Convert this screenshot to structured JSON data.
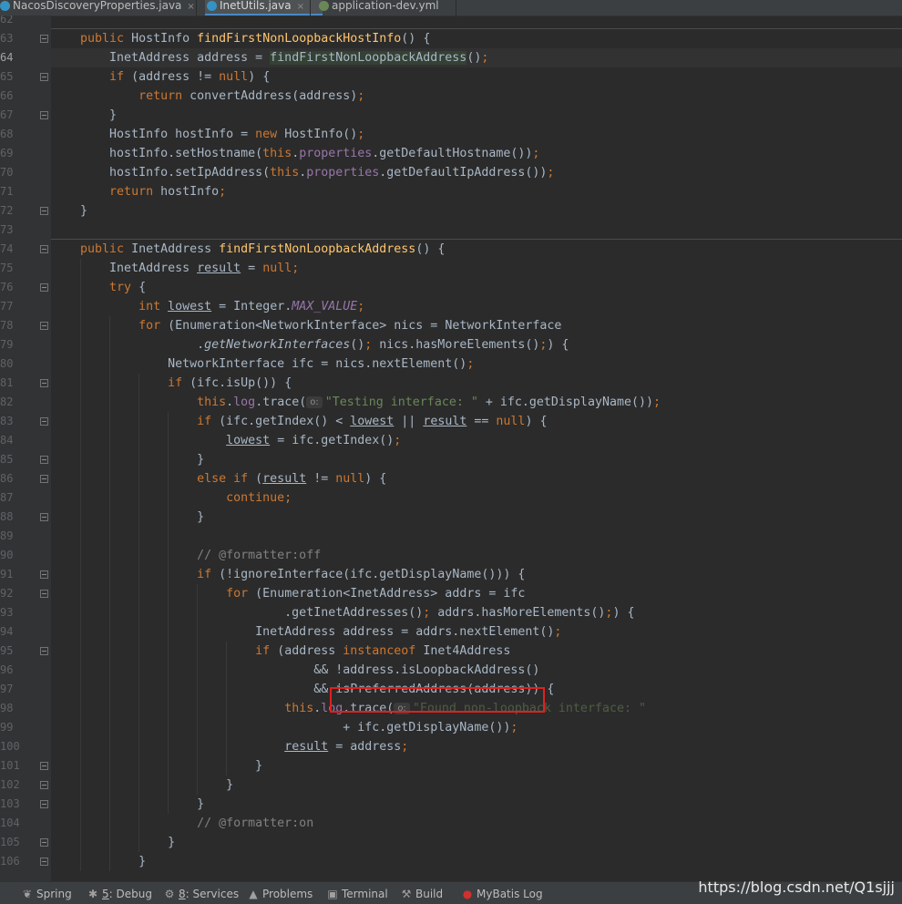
{
  "tabs": [
    {
      "label": "NacosDiscoveryProperties.java",
      "active": false,
      "icon_color": "#3592c4"
    },
    {
      "label": "InetUtils.java",
      "active": true,
      "icon_color": "#3592c4"
    },
    {
      "label": "application-dev.yml",
      "active": false,
      "icon_color": "#6a8759"
    }
  ],
  "tab_close_glyph": "×",
  "current_line": "64",
  "lines": [
    {
      "n": "62",
      "segs": []
    },
    {
      "n": "63",
      "segs": [
        [
          "    ",
          ""
        ],
        [
          "public ",
          "kw"
        ],
        [
          "HostInfo ",
          ""
        ],
        [
          "findFirstNonLoopbackHostInfo",
          "fn"
        ],
        [
          "() {",
          ""
        ]
      ]
    },
    {
      "n": "64",
      "segs": [
        [
          "        InetAddress address = ",
          ""
        ],
        [
          "findFirstNonLoopbackAddress",
          "hl"
        ],
        [
          "()",
          ""
        ],
        [
          ";",
          "kw"
        ]
      ]
    },
    {
      "n": "65",
      "segs": [
        [
          "        ",
          ""
        ],
        [
          "if ",
          "kw"
        ],
        [
          "(address != ",
          ""
        ],
        [
          "null",
          "kw"
        ],
        [
          ") {",
          ""
        ]
      ]
    },
    {
      "n": "66",
      "segs": [
        [
          "            ",
          ""
        ],
        [
          "return ",
          "kw"
        ],
        [
          "convertAddress(address)",
          ""
        ],
        [
          ";",
          "kw"
        ]
      ]
    },
    {
      "n": "67",
      "segs": [
        [
          "        }",
          ""
        ]
      ]
    },
    {
      "n": "68",
      "segs": [
        [
          "        HostInfo hostInfo = ",
          ""
        ],
        [
          "new ",
          "kw"
        ],
        [
          "HostInfo()",
          ""
        ],
        [
          ";",
          "kw"
        ]
      ]
    },
    {
      "n": "69",
      "segs": [
        [
          "        hostInfo.setHostname(",
          ""
        ],
        [
          "this",
          "kw"
        ],
        [
          ".",
          ""
        ],
        [
          "properties",
          "fld"
        ],
        [
          ".getDefaultHostname())",
          ""
        ],
        [
          ";",
          "kw"
        ]
      ]
    },
    {
      "n": "70",
      "segs": [
        [
          "        hostInfo.setIpAddress(",
          ""
        ],
        [
          "this",
          "kw"
        ],
        [
          ".",
          ""
        ],
        [
          "properties",
          "fld"
        ],
        [
          ".getDefaultIpAddress())",
          ""
        ],
        [
          ";",
          "kw"
        ]
      ]
    },
    {
      "n": "71",
      "segs": [
        [
          "        ",
          ""
        ],
        [
          "return ",
          "kw"
        ],
        [
          "hostInfo",
          ""
        ],
        [
          ";",
          "kw"
        ]
      ]
    },
    {
      "n": "72",
      "segs": [
        [
          "    }",
          ""
        ]
      ]
    },
    {
      "n": "73",
      "segs": []
    },
    {
      "n": "74",
      "segs": [
        [
          "    ",
          ""
        ],
        [
          "public ",
          "kw"
        ],
        [
          "InetAddress ",
          ""
        ],
        [
          "findFirstNonLoopbackAddress",
          "fn"
        ],
        [
          "() {",
          ""
        ]
      ]
    },
    {
      "n": "75",
      "segs": [
        [
          "        InetAddress ",
          ""
        ],
        [
          "result",
          "ul"
        ],
        [
          " = ",
          ""
        ],
        [
          "null",
          "kw"
        ],
        [
          ";",
          "kw"
        ]
      ]
    },
    {
      "n": "76",
      "segs": [
        [
          "        ",
          ""
        ],
        [
          "try ",
          "kw"
        ],
        [
          "{",
          ""
        ]
      ]
    },
    {
      "n": "77",
      "segs": [
        [
          "            ",
          ""
        ],
        [
          "int ",
          "kw"
        ],
        [
          "lowest",
          "ul"
        ],
        [
          " = Integer.",
          ""
        ],
        [
          "MAX_VALUE",
          "cst"
        ],
        [
          ";",
          "kw"
        ]
      ]
    },
    {
      "n": "78",
      "segs": [
        [
          "            ",
          ""
        ],
        [
          "for ",
          "kw"
        ],
        [
          "(Enumeration<NetworkInterface> nics = NetworkInterface",
          ""
        ]
      ]
    },
    {
      "n": "79",
      "segs": [
        [
          "                    .",
          ""
        ],
        [
          "getNetworkInterfaces",
          "ital"
        ],
        [
          "()",
          ""
        ],
        [
          "; ",
          "kw"
        ],
        [
          "nics.hasMoreElements()",
          ""
        ],
        [
          ";",
          "kw"
        ],
        [
          ") {",
          ""
        ]
      ]
    },
    {
      "n": "80",
      "segs": [
        [
          "                NetworkInterface ifc = nics.nextElement()",
          ""
        ],
        [
          ";",
          "kw"
        ]
      ]
    },
    {
      "n": "81",
      "segs": [
        [
          "                ",
          ""
        ],
        [
          "if ",
          "kw"
        ],
        [
          "(ifc.isUp()) {",
          ""
        ]
      ]
    },
    {
      "n": "82",
      "segs": [
        [
          "                    ",
          ""
        ],
        [
          "this",
          "kw"
        ],
        [
          ".",
          ""
        ],
        [
          "log",
          "fld"
        ],
        [
          ".trace(",
          ""
        ],
        [
          "o:",
          "hint"
        ],
        [
          "\"Testing interface: \"",
          "str"
        ],
        [
          " + ifc.getDisplayName())",
          ""
        ],
        [
          ";",
          "kw"
        ]
      ]
    },
    {
      "n": "83",
      "segs": [
        [
          "                    ",
          ""
        ],
        [
          "if ",
          "kw"
        ],
        [
          "(ifc.getIndex() < ",
          ""
        ],
        [
          "lowest",
          "ul"
        ],
        [
          " || ",
          ""
        ],
        [
          "result",
          "ul"
        ],
        [
          " == ",
          ""
        ],
        [
          "null",
          "kw"
        ],
        [
          ") {",
          ""
        ]
      ]
    },
    {
      "n": "84",
      "segs": [
        [
          "                        ",
          ""
        ],
        [
          "lowest",
          "ul"
        ],
        [
          " = ifc.getIndex()",
          ""
        ],
        [
          ";",
          "kw"
        ]
      ]
    },
    {
      "n": "85",
      "segs": [
        [
          "                    }",
          ""
        ]
      ]
    },
    {
      "n": "86",
      "segs": [
        [
          "                    ",
          ""
        ],
        [
          "else if ",
          "kw"
        ],
        [
          "(",
          ""
        ],
        [
          "result",
          "ul"
        ],
        [
          " != ",
          ""
        ],
        [
          "null",
          "kw"
        ],
        [
          ") {",
          ""
        ]
      ]
    },
    {
      "n": "87",
      "segs": [
        [
          "                        ",
          ""
        ],
        [
          "continue;",
          "kw"
        ]
      ]
    },
    {
      "n": "88",
      "segs": [
        [
          "                    }",
          ""
        ]
      ]
    },
    {
      "n": "89",
      "segs": []
    },
    {
      "n": "90",
      "segs": [
        [
          "                    ",
          ""
        ],
        [
          "// @formatter:off",
          "cmt"
        ]
      ]
    },
    {
      "n": "91",
      "segs": [
        [
          "                    ",
          ""
        ],
        [
          "if ",
          "kw"
        ],
        [
          "(!ignoreInterface(ifc.getDisplayName())) {",
          ""
        ]
      ]
    },
    {
      "n": "92",
      "segs": [
        [
          "                        ",
          ""
        ],
        [
          "for ",
          "kw"
        ],
        [
          "(Enumeration<InetAddress> addrs = ifc",
          ""
        ]
      ]
    },
    {
      "n": "93",
      "segs": [
        [
          "                                .getInetAddresses()",
          ""
        ],
        [
          "; ",
          "kw"
        ],
        [
          "addrs.hasMoreElements()",
          ""
        ],
        [
          ";",
          "kw"
        ],
        [
          ") {",
          ""
        ]
      ]
    },
    {
      "n": "94",
      "segs": [
        [
          "                            InetAddress address = addrs.nextElement()",
          ""
        ],
        [
          ";",
          "kw"
        ]
      ]
    },
    {
      "n": "95",
      "segs": [
        [
          "                            ",
          ""
        ],
        [
          "if ",
          "kw"
        ],
        [
          "(address ",
          ""
        ],
        [
          "instanceof ",
          "kw"
        ],
        [
          "Inet4Address",
          ""
        ]
      ]
    },
    {
      "n": "96",
      "segs": [
        [
          "                                    && !address.isLoopbackAddress()",
          ""
        ]
      ]
    },
    {
      "n": "97",
      "segs": [
        [
          "                                    && isPreferredAddress(address)) {",
          ""
        ]
      ]
    },
    {
      "n": "98",
      "segs": [
        [
          "                                ",
          ""
        ],
        [
          "this",
          "kw"
        ],
        [
          ".",
          ""
        ],
        [
          "log",
          "fld"
        ],
        [
          ".trace(",
          ""
        ],
        [
          "o:",
          "hint"
        ],
        [
          "\"Found non-loopback interface: \"",
          "str dim"
        ]
      ]
    },
    {
      "n": "99",
      "segs": [
        [
          "                                        + ifc.getDisplayName())",
          ""
        ],
        [
          ";",
          "kw"
        ]
      ]
    },
    {
      "n": "100",
      "segs": [
        [
          "                                ",
          ""
        ],
        [
          "result",
          "ul"
        ],
        [
          " = address",
          ""
        ],
        [
          ";",
          "kw"
        ]
      ]
    },
    {
      "n": "101",
      "segs": [
        [
          "                            }",
          ""
        ]
      ]
    },
    {
      "n": "102",
      "segs": [
        [
          "                        }",
          ""
        ]
      ]
    },
    {
      "n": "103",
      "segs": [
        [
          "                    }",
          ""
        ]
      ]
    },
    {
      "n": "104",
      "segs": [
        [
          "                    ",
          ""
        ],
        [
          "// @formatter:on",
          "cmt"
        ]
      ]
    },
    {
      "n": "105",
      "segs": [
        [
          "                }",
          ""
        ]
      ]
    },
    {
      "n": "106",
      "segs": [
        [
          "            }",
          ""
        ]
      ]
    }
  ],
  "status": [
    {
      "icon": "❦",
      "mnemonic": "",
      "label": "Spring"
    },
    {
      "icon": "✱",
      "mnemonic": "5",
      "label": ": Debug"
    },
    {
      "icon": "⚙",
      "mnemonic": "8",
      "label": ": Services"
    },
    {
      "icon": "▲",
      "mnemonic": "",
      "label": "Problems"
    },
    {
      "icon": "▣",
      "mnemonic": "",
      "label": "Terminal"
    },
    {
      "icon": "⚒",
      "mnemonic": "",
      "label": "Build"
    },
    {
      "icon": "●",
      "mnemonic": "",
      "label": "MyBatis Log"
    }
  ],
  "watermark": "https://blog.csdn.net/Q1sjjj",
  "colors": {
    "keyword": "#cc7832",
    "method": "#ffc66d",
    "field": "#9876aa",
    "string": "#6a8759",
    "comment": "#808080",
    "highlight_box": "#e02020"
  }
}
